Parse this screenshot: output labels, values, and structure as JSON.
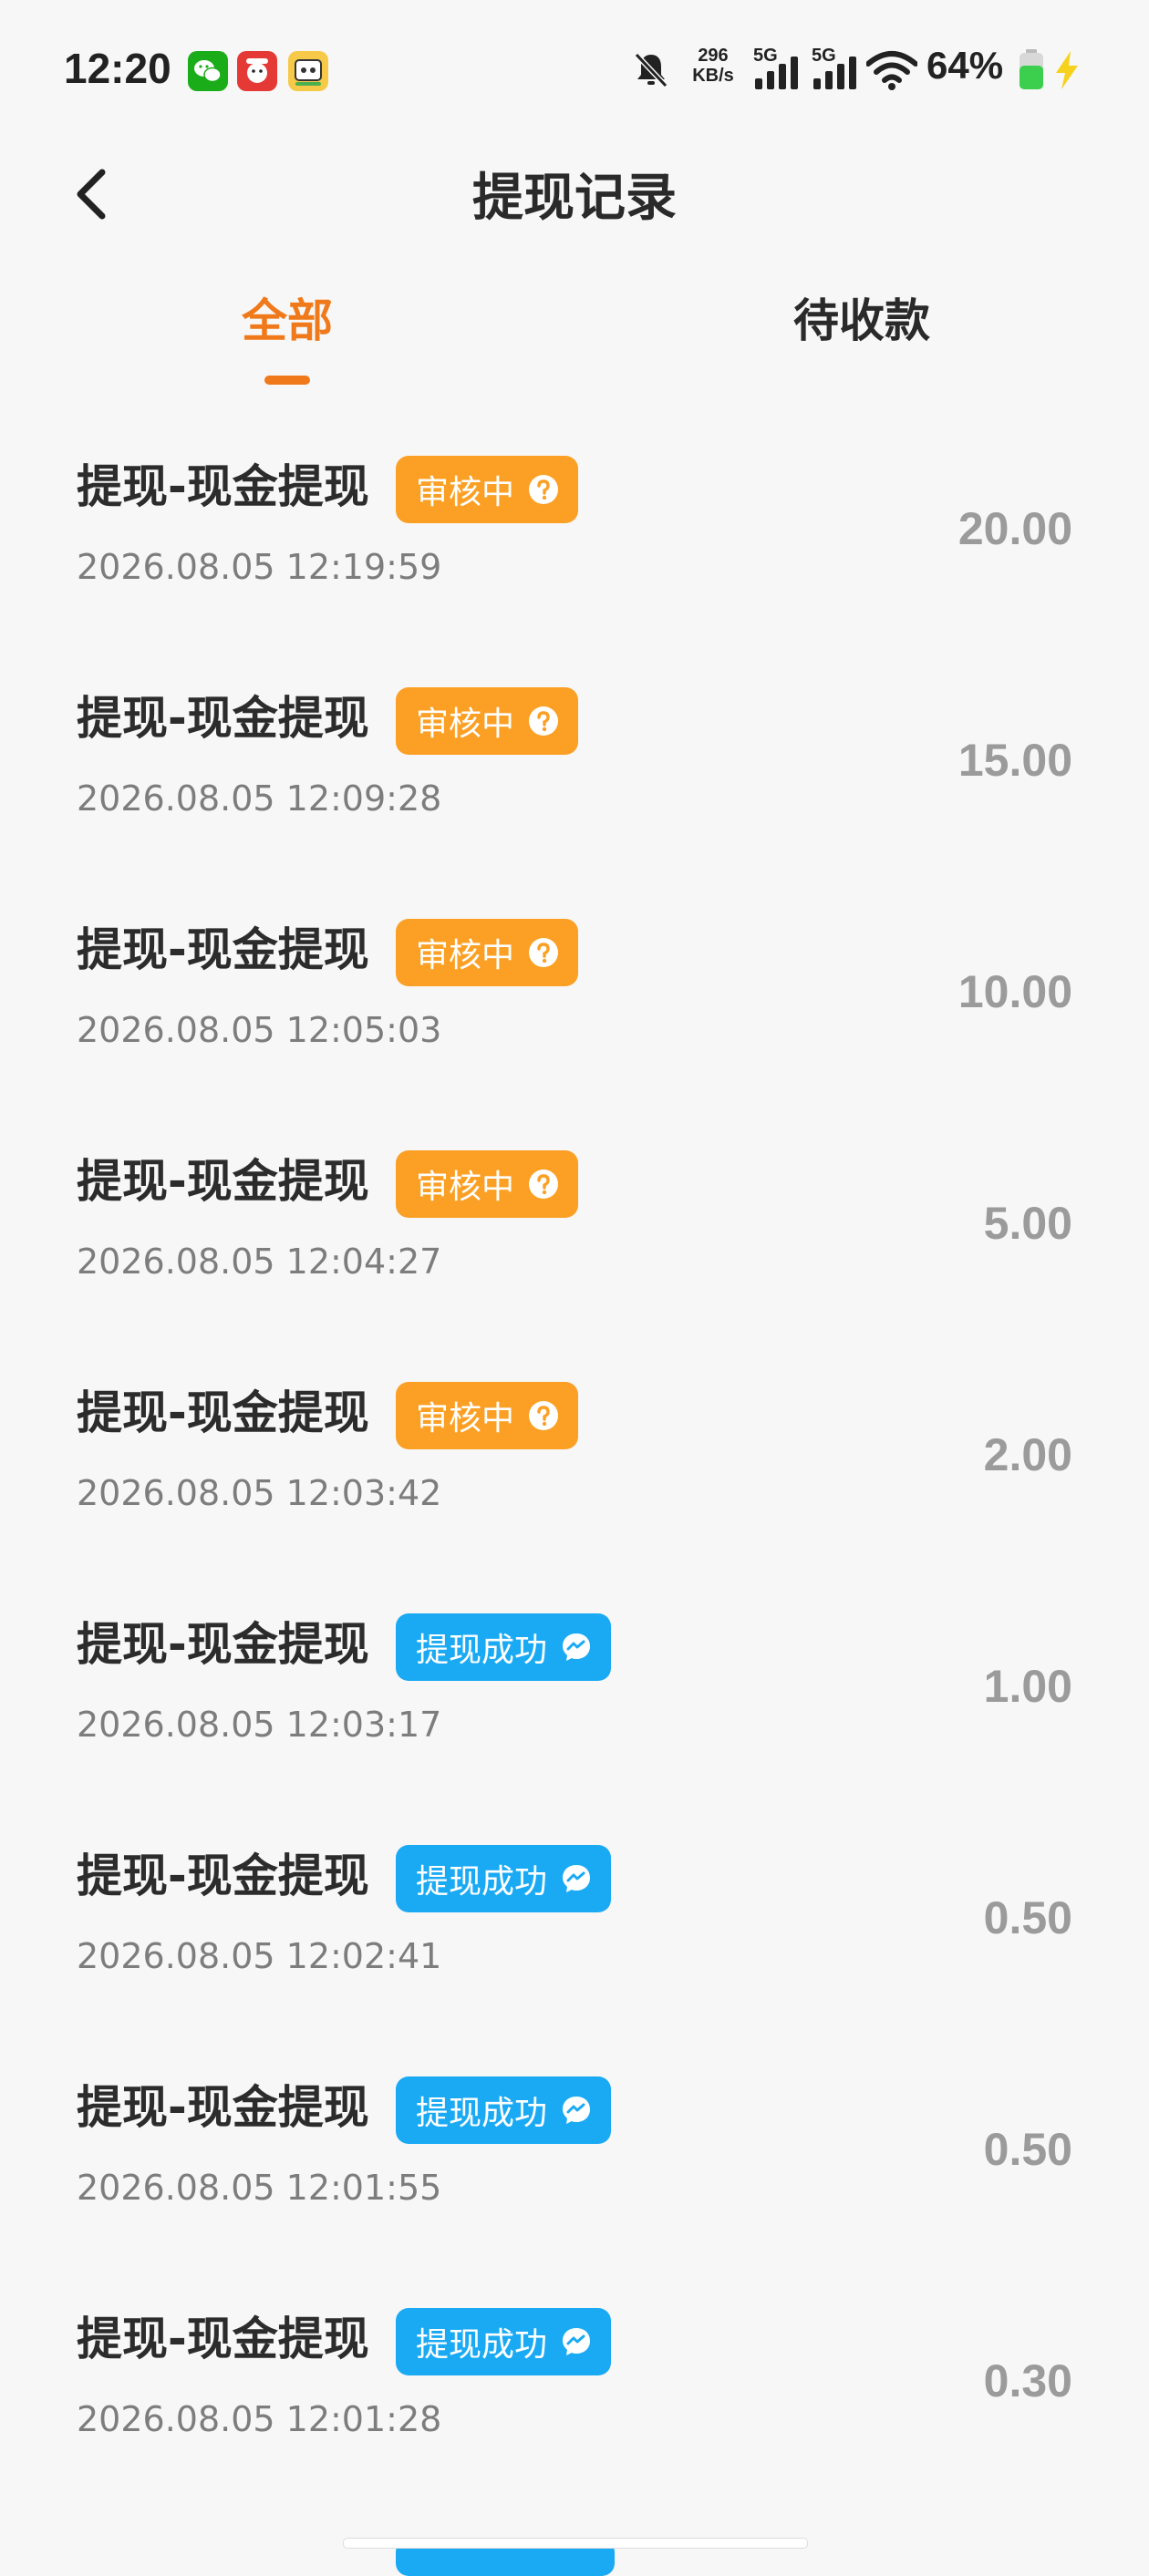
{
  "status_bar": {
    "time": "12:20",
    "net_speed_value": "296",
    "net_speed_unit": "KB/s",
    "signal1_label": "5G",
    "signal2_label": "5G",
    "battery_percent": "64%",
    "apps": [
      "wechat-icon",
      "red-app-icon",
      "game-app-icon"
    ],
    "icons": [
      "bell-muted-icon",
      "signal-icon",
      "signal-icon",
      "wifi-icon",
      "battery-icon",
      "charging-icon"
    ]
  },
  "header": {
    "title": "提现记录",
    "back_icon": "chevron-left-icon"
  },
  "tabs": [
    {
      "label": "全部",
      "active": true
    },
    {
      "label": "待收款",
      "active": false
    }
  ],
  "colors": {
    "accent": "#f07a1b",
    "reviewing_badge": "#fba024",
    "success_badge": "#1aaaf4",
    "amount_text": "#9b9b9b"
  },
  "records": [
    {
      "title": "提现-现金提现",
      "status": "审核中",
      "status_type": "reviewing",
      "status_icon": "question-circle-icon",
      "time": "2026.08.05 12:19:59",
      "amount": "20.00"
    },
    {
      "title": "提现-现金提现",
      "status": "审核中",
      "status_type": "reviewing",
      "status_icon": "question-circle-icon",
      "time": "2026.08.05 12:09:28",
      "amount": "15.00"
    },
    {
      "title": "提现-现金提现",
      "status": "审核中",
      "status_type": "reviewing",
      "status_icon": "question-circle-icon",
      "time": "2026.08.05 12:05:03",
      "amount": "10.00"
    },
    {
      "title": "提现-现金提现",
      "status": "审核中",
      "status_type": "reviewing",
      "status_icon": "question-circle-icon",
      "time": "2026.08.05 12:04:27",
      "amount": "5.00"
    },
    {
      "title": "提现-现金提现",
      "status": "审核中",
      "status_type": "reviewing",
      "status_icon": "question-circle-icon",
      "time": "2026.08.05 12:03:42",
      "amount": "2.00"
    },
    {
      "title": "提现-现金提现",
      "status": "提现成功",
      "status_type": "success",
      "status_icon": "chat-bubble-icon",
      "time": "2026.08.05 12:03:17",
      "amount": "1.00"
    },
    {
      "title": "提现-现金提现",
      "status": "提现成功",
      "status_type": "success",
      "status_icon": "chat-bubble-icon",
      "time": "2026.08.05 12:02:41",
      "amount": "0.50"
    },
    {
      "title": "提现-现金提现",
      "status": "提现成功",
      "status_type": "success",
      "status_icon": "chat-bubble-icon",
      "time": "2026.08.05 12:01:55",
      "amount": "0.50"
    },
    {
      "title": "提现-现金提现",
      "status": "提现成功",
      "status_type": "success",
      "status_icon": "chat-bubble-icon",
      "time": "2026.08.05 12:01:28",
      "amount": "0.30"
    }
  ]
}
